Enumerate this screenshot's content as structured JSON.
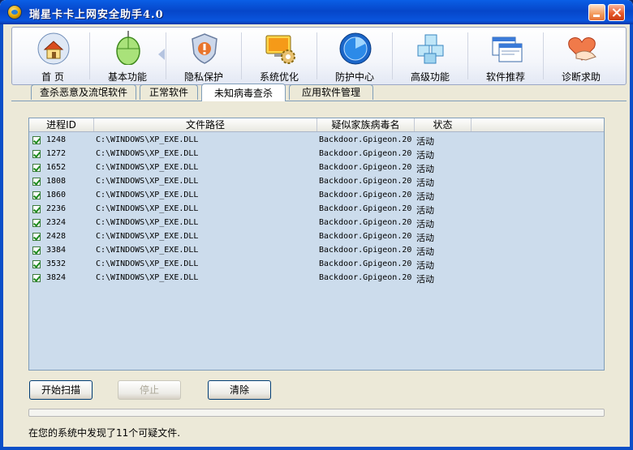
{
  "window": {
    "title": "瑞星卡卡上网安全助手4.0"
  },
  "toolbar": {
    "items": [
      {
        "label": "首 页",
        "icon": "home-icon"
      },
      {
        "label": "基本功能",
        "icon": "mouse-icon"
      },
      {
        "label": "隐私保护",
        "icon": "shield-icon"
      },
      {
        "label": "系统优化",
        "icon": "gear-monitor-icon"
      },
      {
        "label": "防护中心",
        "icon": "radar-icon"
      },
      {
        "label": "高级功能",
        "icon": "cubes-icon"
      },
      {
        "label": "软件推荐",
        "icon": "windows-icon"
      },
      {
        "label": "诊断求助",
        "icon": "heart-hand-icon"
      }
    ]
  },
  "tabs": [
    "查杀恶意及流氓软件",
    "正常软件",
    "未知病毒查杀",
    "应用软件管理"
  ],
  "active_tab": 2,
  "table": {
    "columns": [
      "进程ID",
      "文件路径",
      "疑似家族病毒名",
      "状态"
    ],
    "rows": [
      {
        "pid": "1248",
        "path": "C:\\WINDOWS\\XP_EXE.DLL",
        "virus": "Backdoor.Gpigeon.20(",
        "status": "活动"
      },
      {
        "pid": "1272",
        "path": "C:\\WINDOWS\\XP_EXE.DLL",
        "virus": "Backdoor.Gpigeon.20(",
        "status": "活动"
      },
      {
        "pid": "1652",
        "path": "C:\\WINDOWS\\XP_EXE.DLL",
        "virus": "Backdoor.Gpigeon.20(",
        "status": "活动"
      },
      {
        "pid": "1808",
        "path": "C:\\WINDOWS\\XP_EXE.DLL",
        "virus": "Backdoor.Gpigeon.20(",
        "status": "活动"
      },
      {
        "pid": "1860",
        "path": "C:\\WINDOWS\\XP_EXE.DLL",
        "virus": "Backdoor.Gpigeon.20(",
        "status": "活动"
      },
      {
        "pid": "2236",
        "path": "C:\\WINDOWS\\XP_EXE.DLL",
        "virus": "Backdoor.Gpigeon.20(",
        "status": "活动"
      },
      {
        "pid": "2324",
        "path": "C:\\WINDOWS\\XP_EXE.DLL",
        "virus": "Backdoor.Gpigeon.20(",
        "status": "活动"
      },
      {
        "pid": "2428",
        "path": "C:\\WINDOWS\\XP_EXE.DLL",
        "virus": "Backdoor.Gpigeon.20(",
        "status": "活动"
      },
      {
        "pid": "3384",
        "path": "C:\\WINDOWS\\XP_EXE.DLL",
        "virus": "Backdoor.Gpigeon.20(",
        "status": "活动"
      },
      {
        "pid": "3532",
        "path": "C:\\WINDOWS\\XP_EXE.DLL",
        "virus": "Backdoor.Gpigeon.20(",
        "status": "活动"
      },
      {
        "pid": "3824",
        "path": "C:\\WINDOWS\\XP_EXE.DLL",
        "virus": "Backdoor.Gpigeon.20(",
        "status": "活动"
      }
    ]
  },
  "buttons": {
    "start": "开始扫描",
    "stop": "停止",
    "clear": "清除"
  },
  "progress": 0,
  "status": "在您的系统中发现了11个可疑文件."
}
